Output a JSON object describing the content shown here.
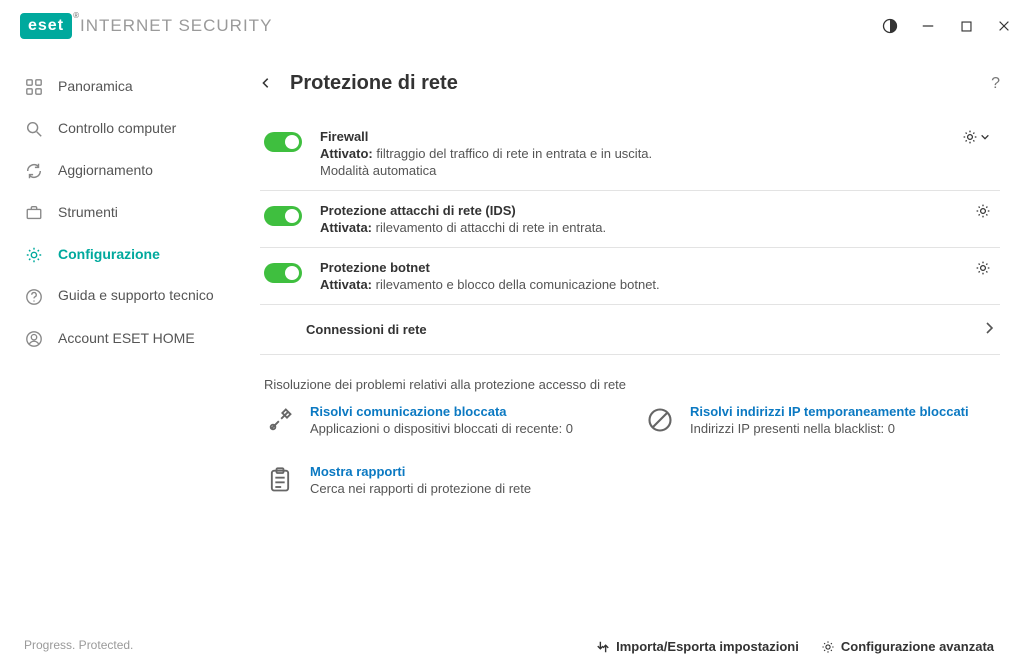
{
  "brand": {
    "logo": "eset",
    "sub": "INTERNET SECURITY",
    "reg": "®"
  },
  "sidebar": {
    "items": [
      {
        "label": "Panoramica"
      },
      {
        "label": "Controllo computer"
      },
      {
        "label": "Aggiornamento"
      },
      {
        "label": "Strumenti"
      },
      {
        "label": "Configurazione"
      },
      {
        "label": "Guida e supporto tecnico"
      },
      {
        "label": "Account ESET HOME"
      }
    ]
  },
  "page": {
    "title": "Protezione di rete"
  },
  "rows": {
    "firewall": {
      "title": "Firewall",
      "status_label": "Attivato:",
      "status_desc": "filtraggio del traffico di rete in entrata e in uscita.",
      "extra": "Modalità automatica"
    },
    "ids": {
      "title": "Protezione attacchi di rete (IDS)",
      "status_label": "Attivata:",
      "status_desc": "rilevamento di attacchi di rete in entrata."
    },
    "botnet": {
      "title": "Protezione botnet",
      "status_label": "Attivata:",
      "status_desc": "rilevamento e blocco della comunicazione botnet."
    },
    "netconn": {
      "title": "Connessioni di rete"
    }
  },
  "troubleshoot": {
    "heading": "Risoluzione dei problemi relativi alla protezione accesso di rete",
    "cards": {
      "blocked_comm": {
        "title": "Risolvi comunicazione bloccata",
        "sub": "Applicazioni o dispositivi bloccati di recente: 0"
      },
      "blocked_ips": {
        "title": "Risolvi indirizzi IP temporaneamente bloccati",
        "sub": "Indirizzi IP presenti nella blacklist: 0"
      },
      "reports": {
        "title": "Mostra rapporti",
        "sub": "Cerca nei rapporti di protezione di rete"
      }
    }
  },
  "main_footer": {
    "import_export": "Importa/Esporta impostazioni",
    "advanced": "Configurazione avanzata"
  },
  "footer_tagline": "Progress. Protected."
}
